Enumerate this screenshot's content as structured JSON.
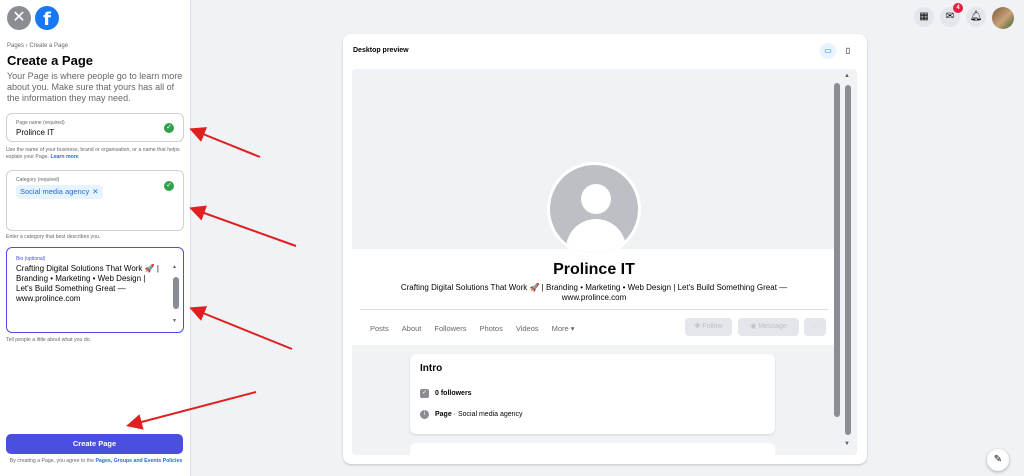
{
  "panel": {
    "breadcrumb": "Pages › Create a Page",
    "title": "Create a Page",
    "intro": "Your Page is where people go to learn more about you. Make sure that yours has all of the information they may need.",
    "page_name": {
      "label": "Page name (required)",
      "value": "Prolince IT",
      "help": "Use the name of your business, brand or organisation, or a name that helps explain your Page.",
      "help_link": "Learn more"
    },
    "category": {
      "label": "Category (required)",
      "chip": "Social media agency",
      "help": "Enter a category that best describes you."
    },
    "bio": {
      "label": "Bio (optional)",
      "value": "Crafting Digital Solutions That Work 🚀 | Branding • Marketing • Web Design | Let's Build Something Great — www.prolince.com",
      "help": "Tell people a little about what you do."
    },
    "create_button": "Create Page",
    "terms_prefix": "By creating a Page, you agree to the",
    "terms_link": "Pages, Groups and Events Policies"
  },
  "topbar": {
    "messenger_badge": "4"
  },
  "preview": {
    "title": "Desktop preview",
    "page_name": "Prolince IT",
    "bio": "Crafting Digital Solutions That Work 🚀 | Branding • Marketing • Web Design | Let's Build Something Great — www.prolince.com",
    "tabs": [
      "Posts",
      "About",
      "Followers",
      "Photos",
      "Videos",
      "More ▾"
    ],
    "actions": {
      "follow": "Follow",
      "message": "Message",
      "more": "···"
    },
    "intro": {
      "heading": "Intro",
      "followers": "0 followers",
      "page_label": "Page",
      "page_category": " · Social media agency"
    }
  },
  "colors": {
    "accent": "#4b4fe0",
    "facebook_blue": "#1877f2",
    "success": "#31a24c",
    "annotation_arrow": "#e02020"
  }
}
